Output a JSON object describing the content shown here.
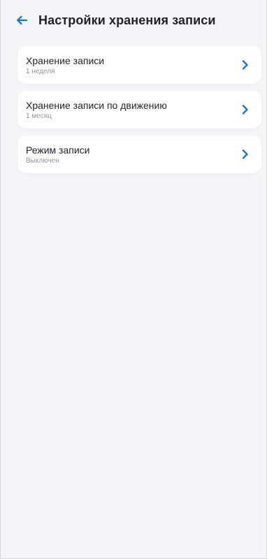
{
  "header": {
    "title": "Настройки хранения записи",
    "back_icon": "arrow-left-icon"
  },
  "settings": [
    {
      "title": "Хранение записи",
      "value": "1 неделя",
      "icon": "chevron-right-icon"
    },
    {
      "title": "Хранение записи по движению",
      "value": "1 месяц",
      "icon": "chevron-right-icon"
    },
    {
      "title": "Режим записи",
      "value": "Выключен",
      "icon": "chevron-right-icon"
    }
  ],
  "colors": {
    "background": "#f3f5f9",
    "card": "#ffffff",
    "title": "#1f2328",
    "subtitle": "#8f969f",
    "accent": "#1673c9"
  }
}
